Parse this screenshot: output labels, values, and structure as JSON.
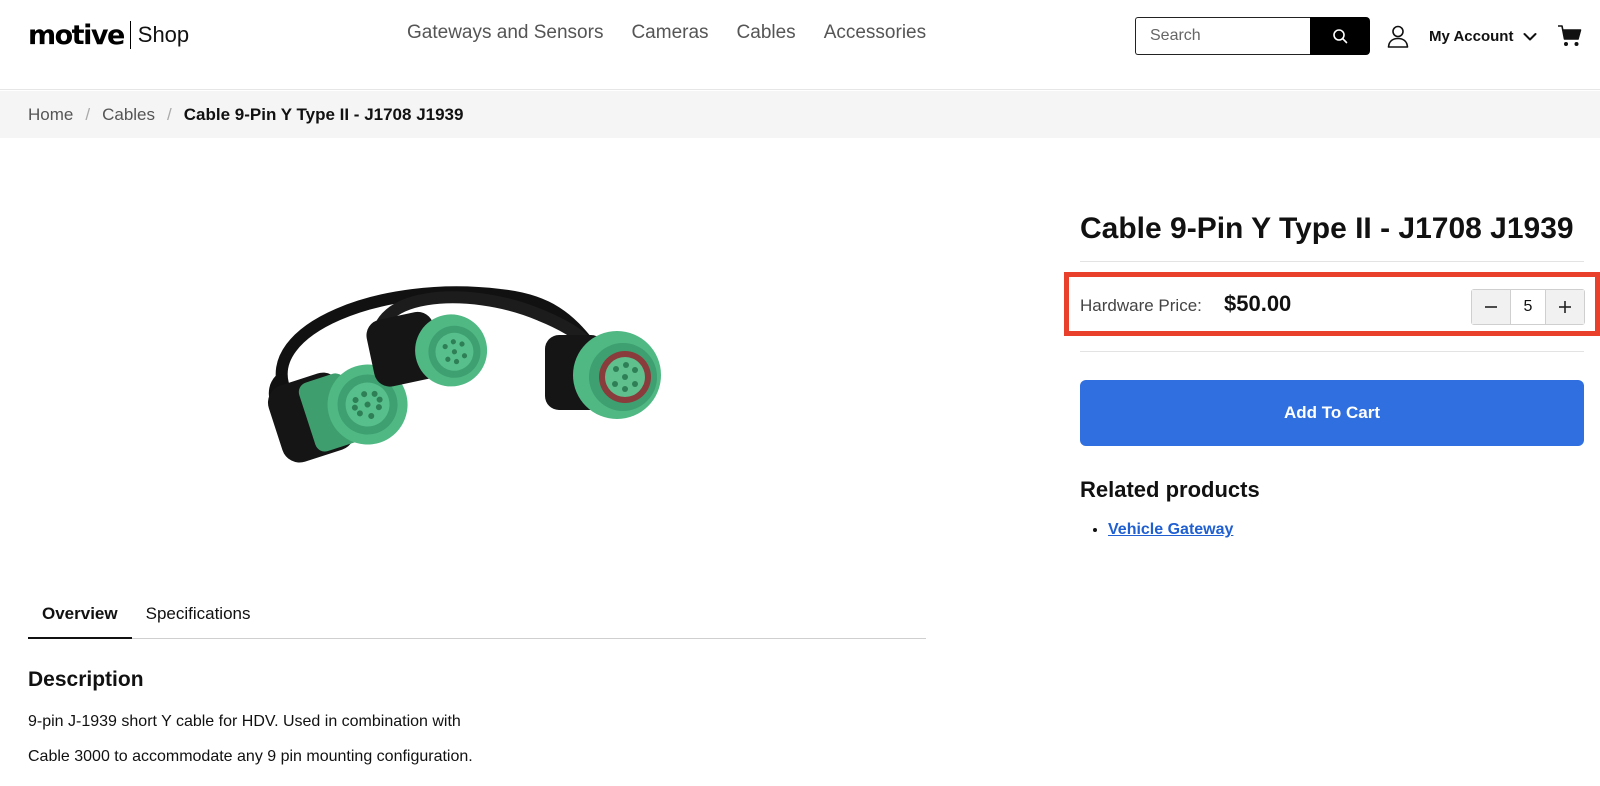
{
  "brand": {
    "wordmark": "motive",
    "suffix": "Shop"
  },
  "nav": [
    {
      "label": "Gateways and Sensors"
    },
    {
      "label": "Cameras"
    },
    {
      "label": "Cables"
    },
    {
      "label": "Accessories"
    }
  ],
  "search": {
    "placeholder": "Search",
    "icon": "search-icon"
  },
  "account": {
    "label": "My Account",
    "icon": "user-icon"
  },
  "cart": {
    "icon": "cart-icon"
  },
  "breadcrumb": [
    {
      "label": "Home"
    },
    {
      "label": "Cables"
    },
    {
      "label": "Cable 9-Pin Y Type II - J1708 J1939"
    }
  ],
  "tabs": [
    {
      "label": "Overview",
      "active": true
    },
    {
      "label": "Specifications",
      "active": false
    }
  ],
  "description": {
    "title": "Description",
    "lines": [
      "9-pin J-1939 short Y cable for HDV. Used in combination with",
      "Cable 3000 to accommodate any 9 pin mounting configuration."
    ]
  },
  "product": {
    "title": "Cable 9-Pin Y Type II - J1708 J1939",
    "price_label": "Hardware Price:",
    "price": "$50.00",
    "quantity": "5",
    "add_to_cart": "Add To Cart"
  },
  "related": {
    "title": "Related products",
    "items": [
      {
        "label": "Vehicle Gateway"
      }
    ]
  },
  "colors": {
    "accent": "#2f6fe0",
    "highlight": "#e8402a",
    "connector_green": "#4fb883"
  }
}
